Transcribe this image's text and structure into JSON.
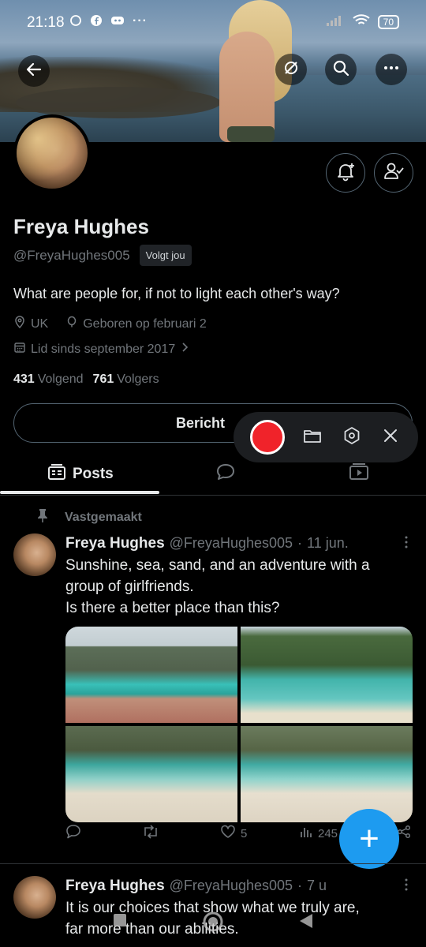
{
  "status": {
    "time": "21:18",
    "battery": "70"
  },
  "profile": {
    "name": "Freya Hughes",
    "handle": "@FreyaHughes005",
    "follows_badge": "Volgt jou",
    "bio": "What are people for, if not to light each other's way?",
    "location": "UK",
    "birthday": "Geboren op februari 2",
    "joined": "Lid sinds september 2017",
    "following_count": "431",
    "following_label": "Volgend",
    "followers_count": "761",
    "followers_label": "Volgers",
    "message_label": "Bericht"
  },
  "tabs": {
    "posts": "Posts"
  },
  "pinned_label": "Vastgemaakt",
  "posts": [
    {
      "name": "Freya Hughes",
      "handle": "@FreyaHughes005",
      "sep": "·",
      "time": "11 jun.",
      "text_lines": [
        "Sunshine, sea, sand, and an adventure with a",
        "group of girlfriends.",
        "Is there a better place than this?"
      ],
      "likes": "5",
      "views": "245"
    },
    {
      "name": "Freya Hughes",
      "handle": "@FreyaHughes005",
      "sep": "·",
      "time": "7 u",
      "text_lines": [
        "It is our choices that show what we truly are,",
        "far more than our abilities."
      ]
    }
  ],
  "fab_label": "+",
  "colors": {
    "accent": "#1d9bf0",
    "record": "#f0232a",
    "background": "#000000"
  }
}
